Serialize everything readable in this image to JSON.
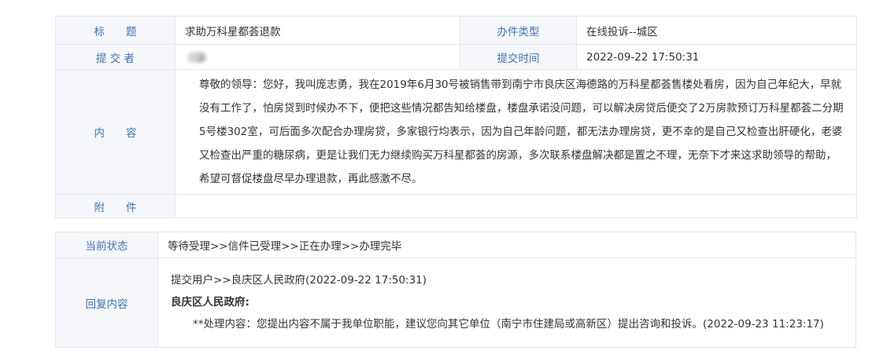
{
  "details": {
    "title_label": "标　　题",
    "title_value": "求助万科星都荟退款",
    "type_label": "办件类型",
    "type_value": "在线投诉--城区",
    "submitter_label": "提 交 者",
    "submit_time_label": "提交时间",
    "submit_time_value": "2022-09-22 17:50:31",
    "content_label": "内　　容",
    "content_value": "尊敬的领导：您好，我叫庞志勇，我在2019年6月30号被销售带到南宁市良庆区海德路的万科星都荟售楼处看房，因为自己年纪大，早就没有工作了，怕房贷到时候办不下，便把这些情况都告知给楼盘，楼盘承诺没问题，可以解决房贷后便交了2万房款预订万科星都荟二分期5号楼302室，可后面多次配合办理房贷，多家银行均表示，因为自己年龄问题，都无法办理房贷，更不幸的是自己又检查出肝硬化，老婆又检查出严重的糖尿病，更是让我们无力继续购买万科星都荟的房源，多次联系楼盘解决都是置之不理，无奈下才来这求助领导的帮助，希望可督促楼盘尽早办理退款，再此感激不尽。",
    "attachment_label": "附　　件"
  },
  "status": {
    "status_label": "当前状态",
    "status_value": "等待受理>>信件已受理>>正在办理>>办理完毕",
    "reply_label": "回复内容",
    "reply_route": "提交用户>>良庆区人民政府(2022-09-22 17:50:31)",
    "reply_org": "良庆区人民政府:",
    "reply_body": "**处理内容：您提出内容不属于我单位职能，建议您向其它单位（南宁市住建局或高新区）提出咨询和投诉。(2022-09-23 11:23:17)"
  }
}
